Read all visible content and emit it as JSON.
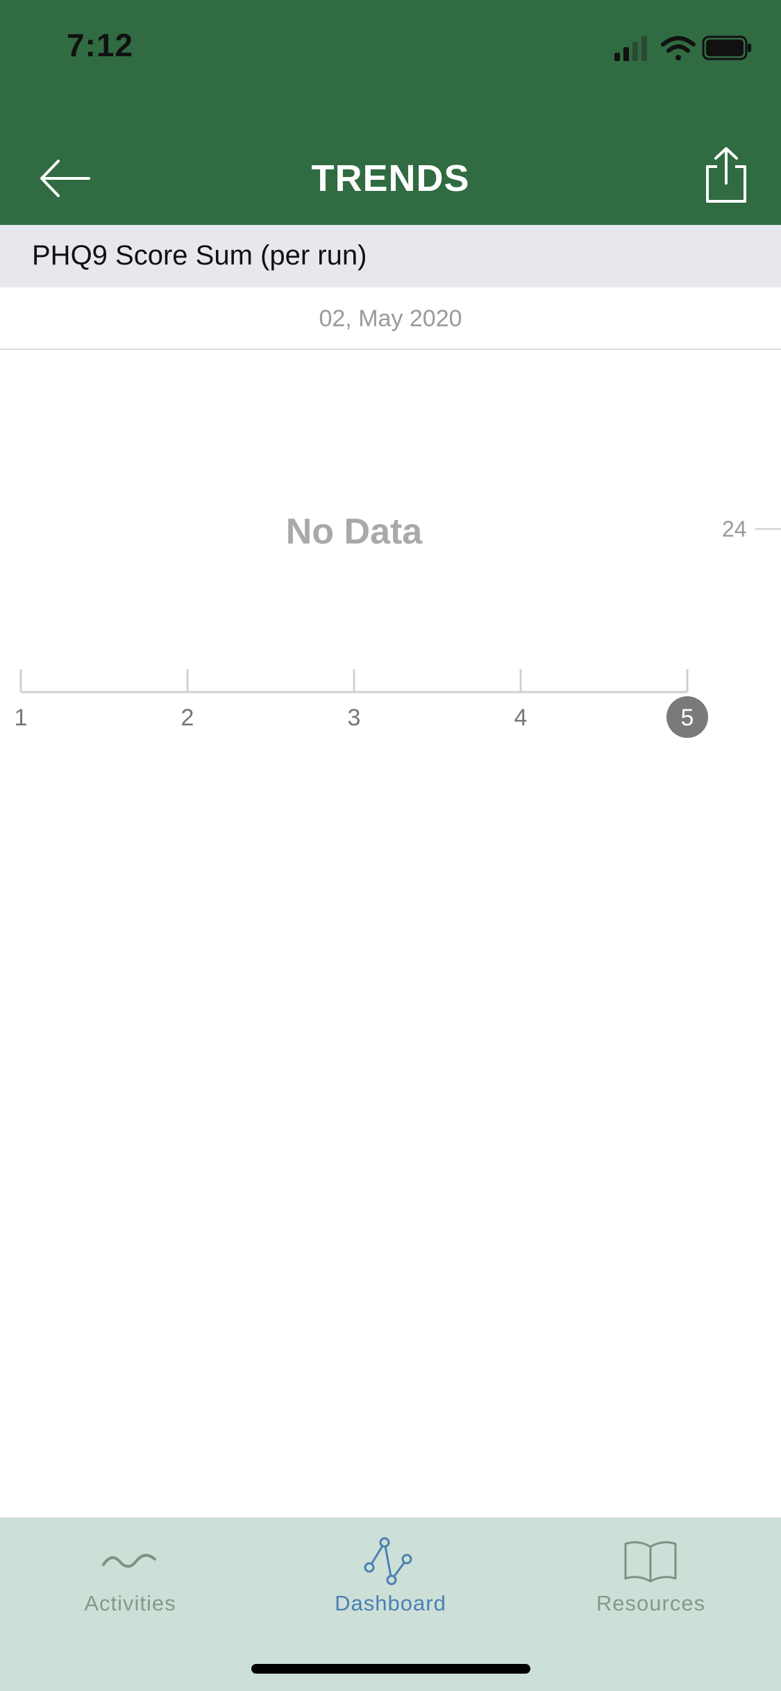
{
  "status_bar": {
    "time": "7:12",
    "icons": [
      "cellular-signal-icon",
      "wifi-icon",
      "battery-icon"
    ]
  },
  "header": {
    "title": "TRENDS",
    "back_icon": "arrow-left-icon",
    "share_icon": "share-icon",
    "background_color": "#316b42"
  },
  "section": {
    "title": "PHQ9 Score Sum (per run)"
  },
  "date": "02, May 2020",
  "chart": {
    "empty_message": "No Data",
    "y_axis_label": "24",
    "x_ticks": [
      "1",
      "2",
      "3",
      "4",
      "5"
    ],
    "selected_tick": "5"
  },
  "chart_data": {
    "type": "line",
    "categories": [
      "1",
      "2",
      "3",
      "4",
      "5"
    ],
    "series": [],
    "yticks": [
      "24"
    ]
  },
  "tabbar": {
    "tabs": [
      {
        "label": "Activities",
        "icon": "wave-icon",
        "active": false
      },
      {
        "label": "Dashboard",
        "icon": "line-chart-icon",
        "active": true
      },
      {
        "label": "Resources",
        "icon": "book-icon",
        "active": false
      }
    ],
    "active_color": "#4b7fb4",
    "inactive_color": "#829a8e"
  }
}
